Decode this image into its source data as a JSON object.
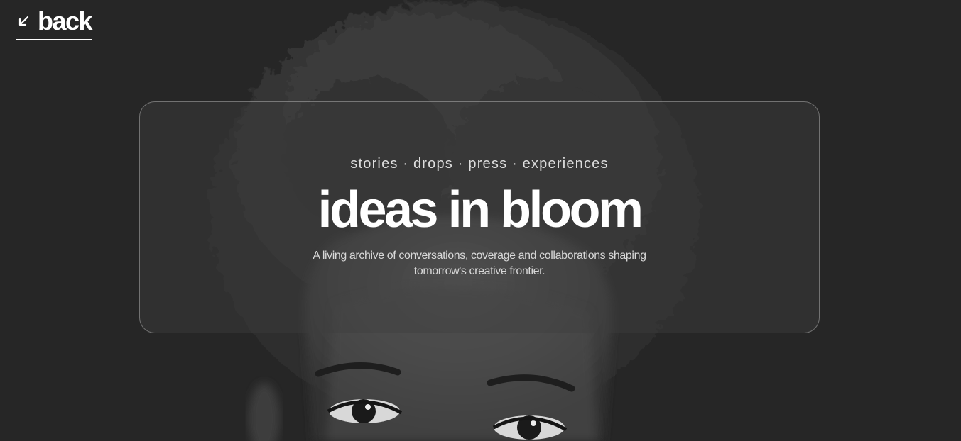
{
  "nav": {
    "back_label": "back",
    "back_icon": "arrow-down-left-icon"
  },
  "hero": {
    "tagline": "stories · drops · press · experiences",
    "headline": "ideas in bloom",
    "description": "A living archive of conversations, coverage and collaborations shaping tomorrow's creative frontier."
  },
  "background": {
    "image": "black-and-white portrait",
    "colors": {
      "page": "#262626",
      "text": "#ffffff",
      "muted_text": "#d8d8d8"
    }
  }
}
